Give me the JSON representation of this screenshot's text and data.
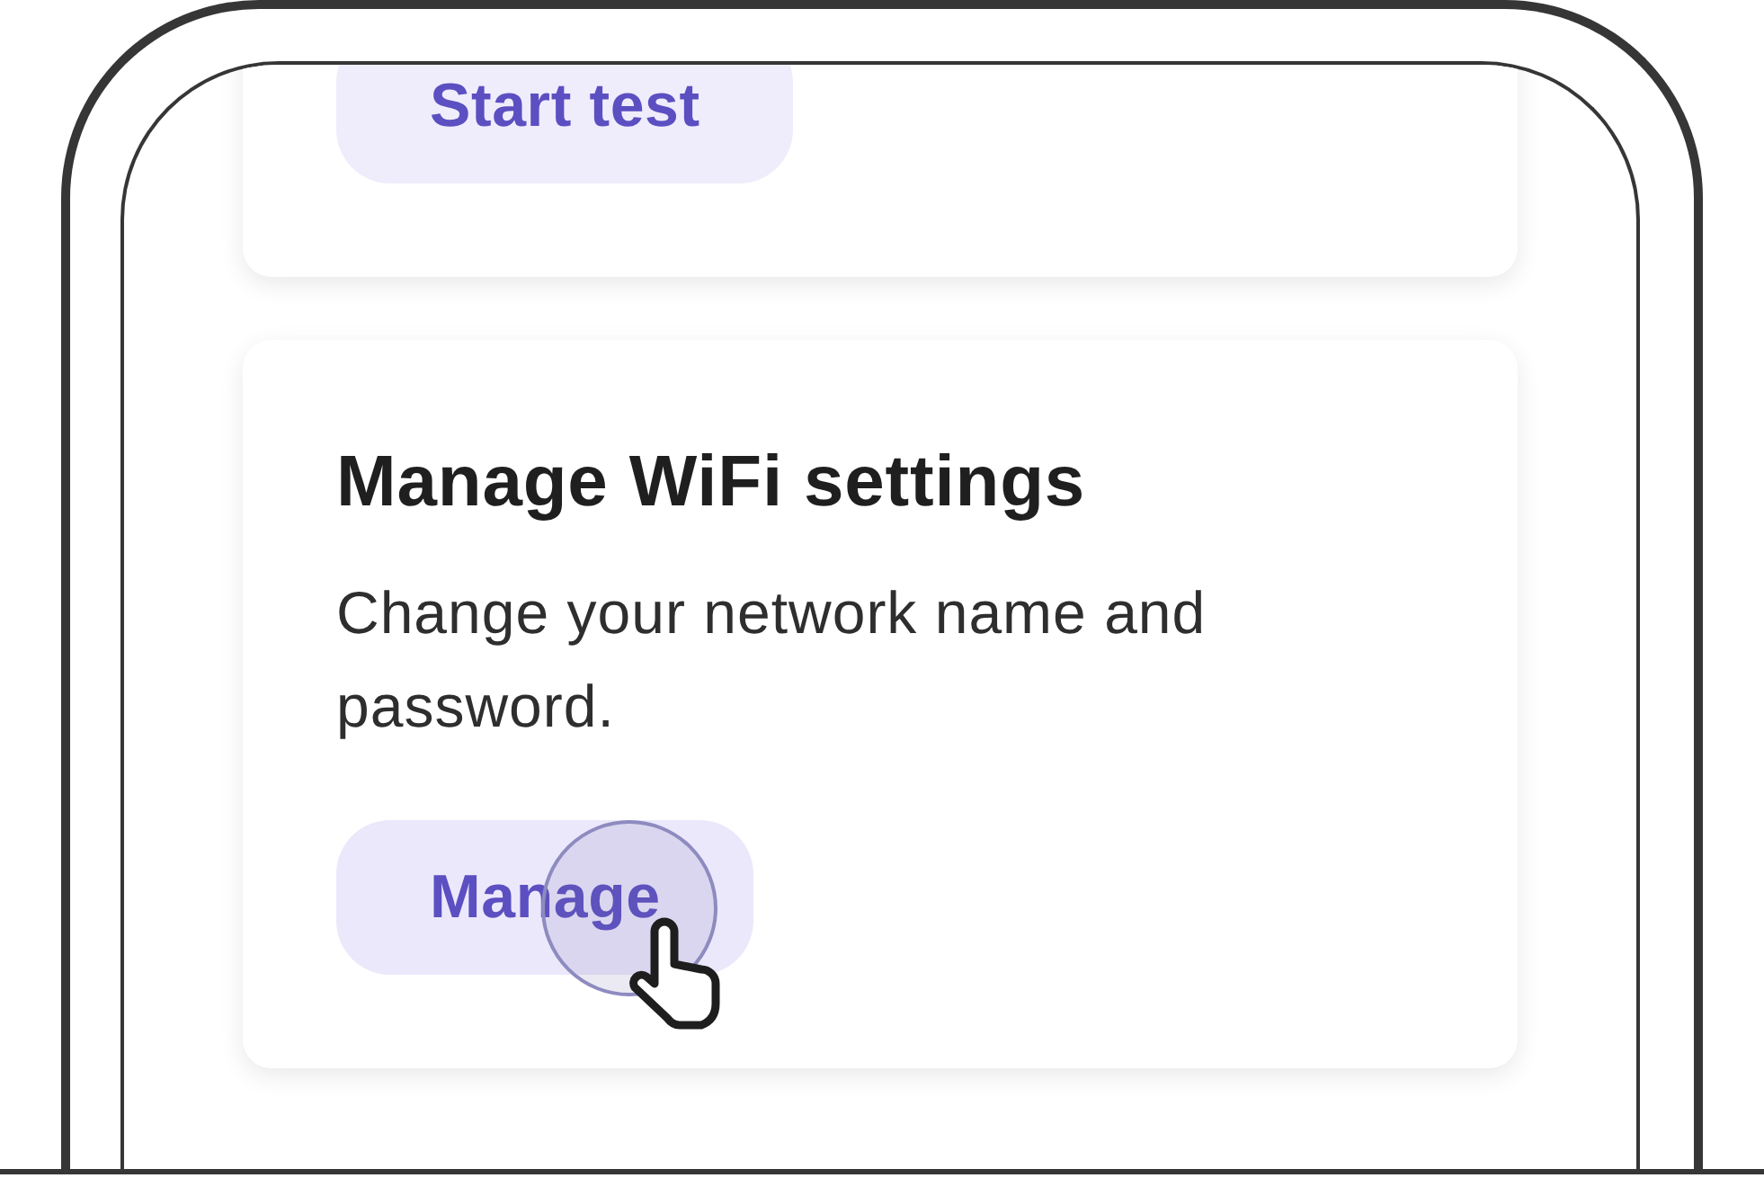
{
  "cards": [
    {
      "button": {
        "label": "Start test",
        "tapped": false
      }
    },
    {
      "title": "Manage WiFi settings",
      "description": "Change your network name and password.",
      "button": {
        "label": "Manage",
        "tapped": true
      }
    }
  ]
}
